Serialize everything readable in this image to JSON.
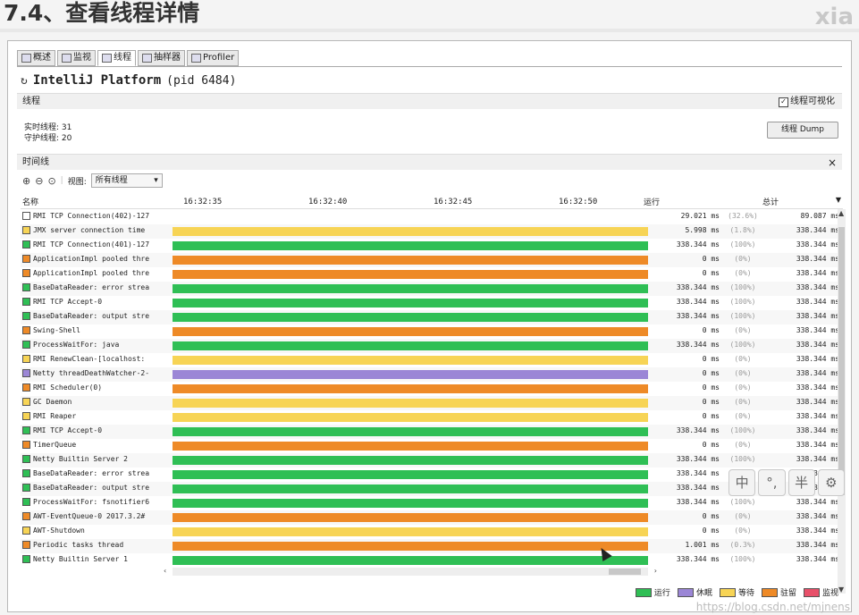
{
  "heading": "7.4、查看线程详情",
  "watermark_corner": "xia",
  "footer_watermark": "https://blog.csdn.net/mjnens",
  "tabs": [
    {
      "label": "概述",
      "icon": "overview-icon"
    },
    {
      "label": "监视",
      "icon": "monitor-icon"
    },
    {
      "label": "线程",
      "icon": "threads-icon"
    },
    {
      "label": "抽样器",
      "icon": "sampler-icon"
    },
    {
      "label": "Profiler",
      "icon": "profiler-icon"
    }
  ],
  "active_tab": 2,
  "app_title": "IntelliJ Platform",
  "pid": "(pid 6484)",
  "threads_section": {
    "label": "线程",
    "visualize_label": "线程可视化",
    "visualize_checked": true,
    "live_label": "实时线程: 31",
    "daemon_label": "守护线程: 20",
    "dump_button": "线程 Dump"
  },
  "timeline_section": {
    "label": "时间线",
    "view_label": "视图:",
    "view_value": "所有线程"
  },
  "columns": {
    "name": "名称",
    "running": "运行",
    "total": "总计"
  },
  "time_ticks": [
    "16:32:35",
    "16:32:40",
    "16:32:45",
    "16:32:50"
  ],
  "colors": {
    "running": "#2fbf55",
    "sleeping": "#9b86d6",
    "waiting": "#f7d455",
    "parked": "#ee8a27",
    "monitor": "#e8506a"
  },
  "rows": [
    {
      "name": "RMI TCP Connection(402)-127",
      "state": "none",
      "running": "29.021 ms",
      "pct": "(32.6%)",
      "total": "89.087 ms"
    },
    {
      "name": "JMX server connection time",
      "state": "waiting",
      "running": "5.998 ms",
      "pct": "(1.8%)",
      "total": "338.344 ms"
    },
    {
      "name": "RMI TCP Connection(401)-127",
      "state": "running",
      "running": "338.344 ms",
      "pct": "(100%)",
      "total": "338.344 ms"
    },
    {
      "name": "ApplicationImpl pooled thre",
      "state": "parked",
      "running": "0 ms",
      "pct": "(0%)",
      "total": "338.344 ms"
    },
    {
      "name": "ApplicationImpl pooled thre",
      "state": "parked",
      "running": "0 ms",
      "pct": "(0%)",
      "total": "338.344 ms"
    },
    {
      "name": "BaseDataReader: error strea",
      "state": "running",
      "running": "338.344 ms",
      "pct": "(100%)",
      "total": "338.344 ms"
    },
    {
      "name": "RMI TCP Accept-0",
      "state": "running",
      "running": "338.344 ms",
      "pct": "(100%)",
      "total": "338.344 ms"
    },
    {
      "name": "BaseDataReader: output stre",
      "state": "running",
      "running": "338.344 ms",
      "pct": "(100%)",
      "total": "338.344 ms"
    },
    {
      "name": "Swing-Shell",
      "state": "parked",
      "running": "0 ms",
      "pct": "(0%)",
      "total": "338.344 ms"
    },
    {
      "name": "ProcessWaitFor: java",
      "state": "running",
      "running": "338.344 ms",
      "pct": "(100%)",
      "total": "338.344 ms"
    },
    {
      "name": "RMI RenewClean-[localhost:",
      "state": "waiting",
      "running": "0 ms",
      "pct": "(0%)",
      "total": "338.344 ms"
    },
    {
      "name": "Netty threadDeathWatcher-2-",
      "state": "sleeping",
      "running": "0 ms",
      "pct": "(0%)",
      "total": "338.344 ms"
    },
    {
      "name": "RMI Scheduler(0)",
      "state": "parked",
      "running": "0 ms",
      "pct": "(0%)",
      "total": "338.344 ms"
    },
    {
      "name": "GC Daemon",
      "state": "waiting",
      "running": "0 ms",
      "pct": "(0%)",
      "total": "338.344 ms"
    },
    {
      "name": "RMI Reaper",
      "state": "waiting",
      "running": "0 ms",
      "pct": "(0%)",
      "total": "338.344 ms"
    },
    {
      "name": "RMI TCP Accept-0",
      "state": "running",
      "running": "338.344 ms",
      "pct": "(100%)",
      "total": "338.344 ms"
    },
    {
      "name": "TimerQueue",
      "state": "parked",
      "running": "0 ms",
      "pct": "(0%)",
      "total": "338.344 ms"
    },
    {
      "name": "Netty Builtin Server 2",
      "state": "running",
      "running": "338.344 ms",
      "pct": "(100%)",
      "total": "338.344 ms"
    },
    {
      "name": "BaseDataReader: error strea",
      "state": "running",
      "running": "338.344 ms",
      "pct": "(100%)",
      "total": "338.344 ms"
    },
    {
      "name": "BaseDataReader: output stre",
      "state": "running",
      "running": "338.344 ms",
      "pct": "(100%)",
      "total": "338.344 ms"
    },
    {
      "name": "ProcessWaitFor: fsnotifier6",
      "state": "running",
      "running": "338.344 ms",
      "pct": "(100%)",
      "total": "338.344 ms"
    },
    {
      "name": "AWT-EventQueue-0 2017.3.2#",
      "state": "parked",
      "running": "0 ms",
      "pct": "(0%)",
      "total": "338.344 ms"
    },
    {
      "name": "AWT-Shutdown",
      "state": "waiting",
      "running": "0 ms",
      "pct": "(0%)",
      "total": "338.344 ms"
    },
    {
      "name": "Periodic tasks thread",
      "state": "parked",
      "running": "1.001 ms",
      "pct": "(0.3%)",
      "total": "338.344 ms"
    },
    {
      "name": "Netty Builtin Server 1",
      "state": "running",
      "running": "338.344 ms",
      "pct": "(100%)",
      "total": "338.344 ms"
    }
  ],
  "legend": [
    {
      "label": "运行",
      "state": "running"
    },
    {
      "label": "休眠",
      "state": "sleeping"
    },
    {
      "label": "等待",
      "state": "waiting"
    },
    {
      "label": "驻留",
      "state": "parked"
    },
    {
      "label": "监视",
      "state": "monitor"
    }
  ],
  "ime_toolbar": [
    "中",
    "°,",
    "半",
    "⚙"
  ]
}
